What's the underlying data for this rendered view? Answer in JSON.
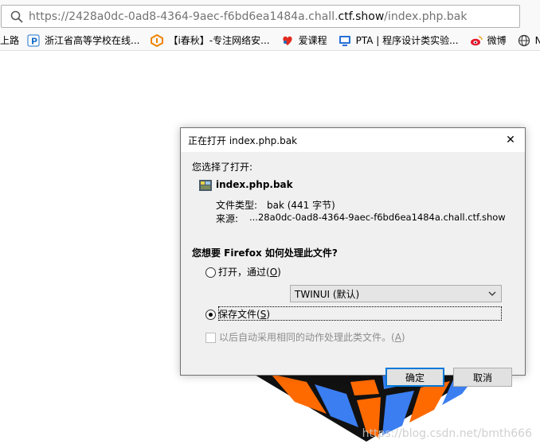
{
  "browser": {
    "url_prefix": "https://2428a0dc-0ad8-4364-9aec-f6bd6ea1484a.chall.",
    "url_domain": "ctf.show",
    "url_suffix": "/index.php.bak",
    "bookmarks": [
      {
        "label": "上路",
        "icon": "none"
      },
      {
        "label": "浙江省高等学校在线...",
        "icon": "p-logo-icon"
      },
      {
        "label": "【i春秋】-专注网络安...",
        "icon": "ichunqiu-icon"
      },
      {
        "label": "爱课程",
        "icon": "aikecheng-icon"
      },
      {
        "label": "PTA | 程序设计类实验...",
        "icon": "pta-icon"
      },
      {
        "label": "微博",
        "icon": "weibo-icon"
      },
      {
        "label": "Ne",
        "icon": "globe-icon"
      }
    ]
  },
  "dialog": {
    "title": "正在打开 index.php.bak",
    "chosen_label": "您选择了打开:",
    "file_name": "index.php.bak",
    "file_type_label": "文件类型:",
    "file_type_value": "bak (441 字节)",
    "source_label": "来源:",
    "source_value": "...28a0dc-0ad8-4364-9aec-f6bd6ea1484a.chall.ctf.show",
    "question": "您想要 Firefox 如何处理此文件?",
    "open_with_label": "打开，通过(",
    "open_with_key": "O",
    "open_with_app": "TWINUI (默认)",
    "save_file_label": "保存文件(",
    "save_file_key": "S",
    "auto_label": "以后自动采用相同的动作处理此类文件。(",
    "auto_key": "A",
    "ok": "确定",
    "cancel": "取消",
    "close_symbol": "✕"
  },
  "page": {
    "watermark": "https://blog.csdn.net/bmth666"
  },
  "colors": {
    "accent": "#0078d7",
    "cube_orange": "#ff6a00",
    "cube_blue": "#3a7ef2",
    "cube_black": "#111111"
  }
}
